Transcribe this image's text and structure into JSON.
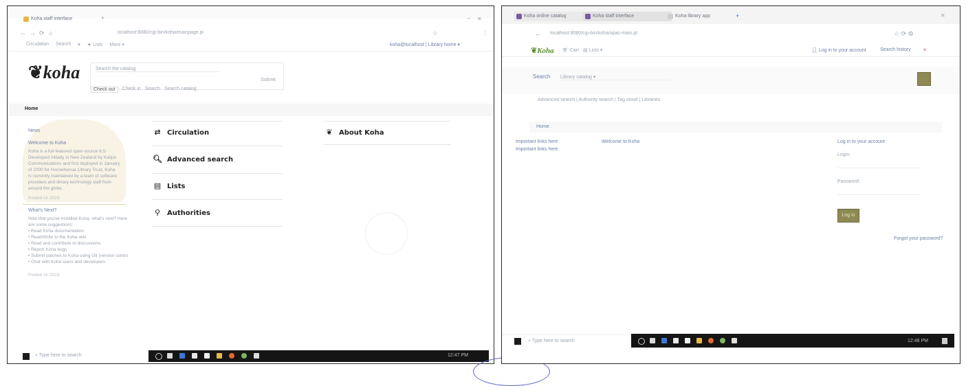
{
  "left": {
    "tabs": [
      {
        "label": "Koha staff interface"
      }
    ],
    "new_tab": "+",
    "window_controls": "–",
    "nav": {
      "back": "←",
      "forward": "→",
      "reload": "⟳",
      "home": "⌂"
    },
    "address": "localhost:8080/cgi-bin/koha/mainpage.pl",
    "toolbar": {
      "items": [
        "Circulation",
        "Search",
        "▾",
        "★ Lists",
        "More ▾"
      ],
      "right_text": "koha@localhost | Library home  ▾"
    },
    "brand": "koha",
    "search": {
      "placeholder": "Search the catalog",
      "submit": "Submit",
      "tabs": [
        "Check out",
        "Check in",
        "Search",
        "Search catalog"
      ]
    },
    "breadcrumb": "Home",
    "news": {
      "title": "News",
      "welcome_title": "Welcome to Koha",
      "welcome_lines": [
        "Koha is a full-featured open-source ILS.",
        "Developed initially in New Zealand by Katipo",
        "Communications and first deployed in January",
        "of 2000 for Horowhenua Library Trust, Koha",
        "is currently maintained by a team of software",
        "providers and library technology staff from",
        "around the globe."
      ],
      "posted_line": "Posted on 2023",
      "next_title": "What's Next?",
      "next_lines": [
        "Now that you've installed Koha, what's next? Here",
        "are some suggestions:",
        "• Read Koha documentation",
        "• Read/Write to the Koha wiki",
        "• Read and contribute to discussions",
        "• Report Koha bugs",
        "• Submit patches to Koha using Git (version control)",
        "• Chat with Koha users and developers"
      ],
      "next_footer": "Posted on 2023"
    },
    "modules": [
      {
        "icon": "⇄",
        "label": "Circulation"
      },
      {
        "icon": "🔍︎",
        "label": "Advanced search"
      },
      {
        "icon": "▤",
        "label": "Lists"
      },
      {
        "icon": "⚲",
        "label": "Authorities"
      }
    ],
    "about": {
      "icon": "❦",
      "label": "About Koha"
    },
    "taskbar": {
      "search_placeholder": "Type here to search",
      "clock": "12:47 PM"
    }
  },
  "right": {
    "tabs": [
      {
        "label": "Koha online catalog"
      },
      {
        "label": "Koha staff interface"
      },
      {
        "label": "Koha library app"
      }
    ],
    "new_tab": "+",
    "address": "localhost:8080/cgi-bin/koha/opac-main.pl",
    "toolbar": {
      "brand": "Koha",
      "cart": "Cart",
      "lists": "Lists ▾",
      "login": "Log in to your account",
      "history": "Search history"
    },
    "search": {
      "label": "Search",
      "placeholder": "Library catalog ▾"
    },
    "links": "Advanced search | Authority search | Tag cloud | Libraries",
    "breadcrumb": "Home",
    "left_links": [
      "Important links here",
      "Important links here"
    ],
    "welcome": "Welcome to Koha",
    "login_panel": {
      "title": "Log in to your account",
      "login_label": "Login:",
      "password_label": "Password:",
      "button": "Log in",
      "forgot": "Forgot your password?"
    },
    "taskbar": {
      "search_placeholder": "Type here to search",
      "clock": "12:48 PM"
    }
  },
  "colors": {
    "accent": "#5a8f29",
    "link": "#6b7fa8",
    "taskbar": "#151515",
    "highlight": "#f3ead0",
    "opac_button": "#8e8a55"
  }
}
